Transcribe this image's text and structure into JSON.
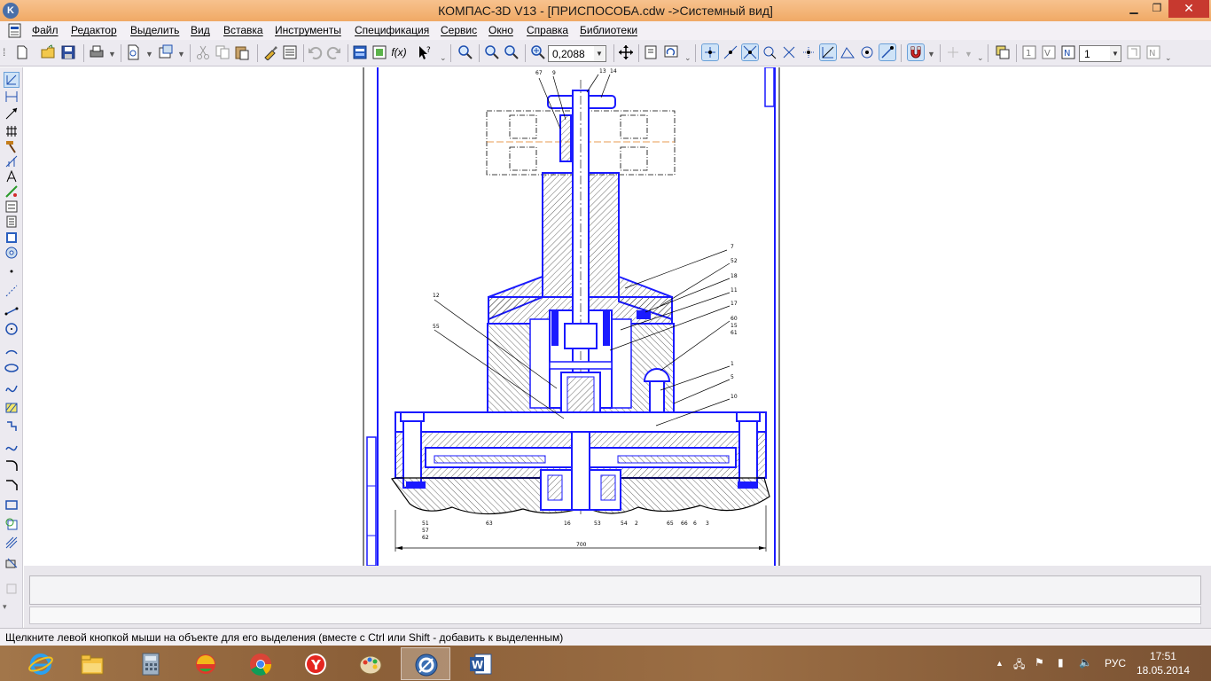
{
  "window": {
    "title": "КОМПАС-3D V13 - [ПРИСПОСОБА.cdw ->Системный вид]",
    "app_icon": "K",
    "controls": [
      "minimize-icon",
      "restore-icon",
      "close-icon"
    ]
  },
  "menu": {
    "items": [
      "Файл",
      "Редактор",
      "Выделить",
      "Вид",
      "Вставка",
      "Инструменты",
      "Спецификация",
      "Сервис",
      "Окно",
      "Справка",
      "Библиотеки"
    ]
  },
  "toolbar": {
    "zoom_value": "0,2088",
    "layer_value": "1"
  },
  "drawing": {
    "part_numbers": [
      "67",
      "9",
      "13",
      "14",
      "7",
      "52",
      "18",
      "11",
      "17",
      "60",
      "15",
      "61",
      "1",
      "5",
      "10",
      "12",
      "55",
      "51",
      "57",
      "62",
      "63",
      "16",
      "53",
      "54",
      "2",
      "65",
      "66",
      "6",
      "3"
    ],
    "dimension": "700"
  },
  "status": {
    "hint": "Щелкните левой кнопкой мыши на объекте для его выделения (вместе с Ctrl или Shift - добавить к выделенным)"
  },
  "taskbar": {
    "apps": [
      "ie-icon",
      "explorer-icon",
      "calculator-icon",
      "games-icon",
      "chrome-icon",
      "yandex-icon",
      "paint-icon",
      "kompas-icon",
      "word-icon"
    ],
    "language": "РУС",
    "time": "17:51",
    "date": "18.05.2014"
  }
}
